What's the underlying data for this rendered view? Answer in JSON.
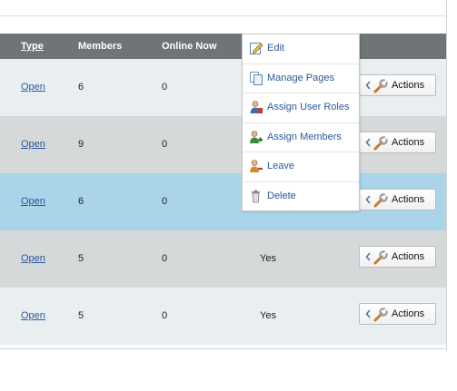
{
  "table": {
    "headers": {
      "type": "Type",
      "members": "Members",
      "online": "Online Now"
    },
    "rows": [
      {
        "type": "Open",
        "members": "6",
        "online": "0",
        "flag": ""
      },
      {
        "type": "Open",
        "members": "9",
        "online": "0",
        "flag": ""
      },
      {
        "type": "Open",
        "members": "6",
        "online": "0",
        "flag": ""
      },
      {
        "type": "Open",
        "members": "5",
        "online": "0",
        "flag": "Yes"
      },
      {
        "type": "Open",
        "members": "5",
        "online": "0",
        "flag": "Yes"
      }
    ],
    "actions_label": "Actions",
    "colors": {
      "header": "#6f7477",
      "row_light": "#e9eff1",
      "row_grey": "#d6d9da",
      "row_selected": "#a9d4ea"
    }
  },
  "menu": {
    "items": [
      {
        "label": "Edit",
        "icon": "edit-icon"
      },
      {
        "label": "Manage Pages",
        "icon": "pages-icon"
      },
      {
        "label": "Assign User Roles",
        "icon": "user-roles-icon"
      },
      {
        "label": "Assign Members",
        "icon": "members-icon"
      },
      {
        "label": "Leave",
        "icon": "leave-icon"
      },
      {
        "label": "Delete",
        "icon": "trash-icon"
      }
    ]
  }
}
